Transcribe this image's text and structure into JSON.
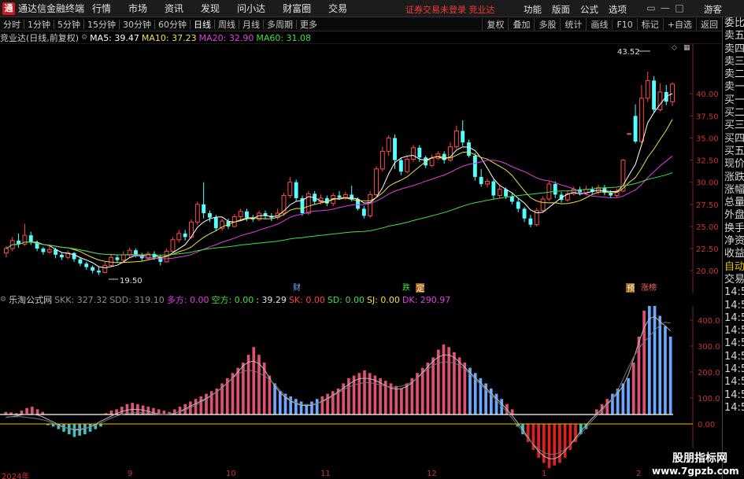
{
  "titlebar": {
    "logo": "通",
    "app_name": "通达信金融终端",
    "menu": [
      "行情",
      "市场",
      "资讯",
      "发现",
      "问小达",
      "财富圈",
      "交易"
    ],
    "alert": "证券交易未登录  竞业达",
    "right_menu": [
      "功能",
      "版面",
      "公式",
      "选项"
    ],
    "guest": "游客"
  },
  "toolbar": {
    "periods": [
      "分时",
      "1分钟",
      "5分钟",
      "15分钟",
      "30分钟",
      "60分钟",
      "日线",
      "周线",
      "月线",
      "多周期",
      "更多"
    ],
    "active_period": "日线",
    "right_buttons": [
      "复权",
      "叠加",
      "多股",
      "统计",
      "画线",
      "F10",
      "标记",
      "+自选",
      "返回"
    ]
  },
  "info": {
    "stock": "竞业达(日线,前复权)",
    "ma5": "MA5: 39.47",
    "ma10": "MA10: 37.23",
    "ma20": "MA20: 32.90",
    "ma60": "MA60: 31.08"
  },
  "indicator": {
    "name": "乐淘公式网",
    "skk": "SKK: 327.32",
    "sdd": "SDD: 319.10",
    "duo": "多方: 0.00",
    "kong": "空方: 0.00",
    "val": ": 39.29",
    "sk": "SK: 0.00",
    "sd": "SD: 0.00",
    "sj": "SJ: 0.00",
    "dk": "DK: 290.97"
  },
  "price_axis": [
    "40.00",
    "37.50",
    "35.00",
    "32.50",
    "30.00",
    "27.50",
    "25.00",
    "22.50",
    "20.00"
  ],
  "ind_axis": [
    "400.0",
    "300.0",
    "200.0",
    "100.0",
    "0.00"
  ],
  "annotations": {
    "high": "43.52",
    "low": "19.50",
    "tag_cai": "财",
    "tag_die": "跌",
    "tag_ding": "定",
    "tag_yu": "预",
    "tag_zhangbang": "涨榜"
  },
  "x_axis": [
    "2024年",
    "9",
    "10",
    "11",
    "12",
    "1",
    "2"
  ],
  "sidebar": [
    "委比",
    "卖五",
    "卖四",
    "卖三",
    "卖二",
    "卖一",
    "买一",
    "买二",
    "买三",
    "买四",
    "买五",
    "现价",
    "涨跌",
    "涨幅",
    "总量",
    "外盘",
    "换手",
    "净资",
    "收益",
    "自动",
    "交易",
    "14:56",
    "14:56",
    "14:56",
    "14:56",
    "14:56",
    "14:56",
    "14:56",
    "14:56",
    "14:56",
    "14:56"
  ],
  "watermark": {
    "line1": "股朋指标网",
    "line2": "www.7gpzb.com"
  },
  "colors": {
    "up": "#ff4a4a",
    "down": "#54ffff",
    "ma5": "#ffffff",
    "ma10": "#f0e040",
    "ma20": "#e040e0",
    "ma60": "#40e040",
    "bar_pos": "#e05070",
    "bar_blue": "#6aa8ff"
  },
  "chart_data": {
    "type": "candlestick",
    "ylim": [
      18.5,
      45
    ],
    "candles": [
      [
        22,
        22.5,
        21.5,
        22.8
      ],
      [
        22.5,
        23.4,
        22.2,
        23.8
      ],
      [
        23.4,
        23,
        22.6,
        24.2
      ],
      [
        23,
        24,
        22.8,
        25.3
      ],
      [
        24,
        23.2,
        22.9,
        24.4
      ],
      [
        23.2,
        22.5,
        22.2,
        23.4
      ],
      [
        22.5,
        22.1,
        21.8,
        22.7
      ],
      [
        22.1,
        22.4,
        21.9,
        22.8
      ],
      [
        22.4,
        21.8,
        21.4,
        22.6
      ],
      [
        21.8,
        21.5,
        21.2,
        22
      ],
      [
        21.5,
        22,
        21.3,
        22.3
      ],
      [
        22,
        21.3,
        21,
        22.1
      ],
      [
        21.3,
        20.8,
        20.5,
        21.5
      ],
      [
        20.8,
        20.4,
        20.1,
        21
      ],
      [
        20.4,
        20,
        19.7,
        20.6
      ],
      [
        20,
        19.8,
        19.5,
        20.4
      ],
      [
        19.8,
        20.6,
        19.7,
        21
      ],
      [
        20.6,
        21.5,
        20.4,
        21.8
      ],
      [
        21.5,
        21.2,
        20.9,
        21.8
      ],
      [
        21.2,
        21.8,
        21,
        22.2
      ],
      [
        21.8,
        22.3,
        21.5,
        22.6
      ],
      [
        22.3,
        21.7,
        21.5,
        22.5
      ],
      [
        21.7,
        21.4,
        21.1,
        22
      ],
      [
        21.4,
        21.9,
        21.2,
        22.2
      ],
      [
        21.9,
        21.5,
        21.2,
        22.2
      ],
      [
        21.5,
        21,
        20.6,
        21.8
      ],
      [
        21,
        22.2,
        20.9,
        22.5
      ],
      [
        22.2,
        23.5,
        22,
        23.8
      ],
      [
        23.5,
        24.2,
        23.2,
        24.6
      ],
      [
        24.2,
        23.8,
        23.4,
        24.6
      ],
      [
        23.8,
        25.5,
        23.6,
        25.8
      ],
      [
        25.5,
        27.5,
        25.2,
        27.8
      ],
      [
        27.5,
        26.5,
        25.9,
        30
      ],
      [
        26.5,
        26,
        25.5,
        26.8
      ],
      [
        26,
        24.8,
        24.5,
        26.3
      ],
      [
        24.8,
        25.6,
        24.5,
        25.9
      ],
      [
        25.6,
        25,
        24.7,
        25.9
      ],
      [
        25,
        26.1,
        24.9,
        26.4
      ],
      [
        26.1,
        26.7,
        25.8,
        27
      ],
      [
        26.7,
        26,
        25.6,
        27
      ],
      [
        26,
        25.8,
        25.5,
        26.3
      ],
      [
        25.8,
        26.5,
        25.6,
        26.8
      ],
      [
        26.5,
        26.2,
        25.8,
        26.8
      ],
      [
        26.2,
        26,
        25.6,
        26.5
      ],
      [
        26,
        26.5,
        25.8,
        27
      ],
      [
        26.5,
        28.5,
        26.2,
        28.8
      ],
      [
        28.5,
        30,
        28.2,
        30.6
      ],
      [
        30,
        28.2,
        27.8,
        30.3
      ],
      [
        28.2,
        26.5,
        26.2,
        28.5
      ],
      [
        26.5,
        28.7,
        26.3,
        29
      ],
      [
        28.7,
        27.8,
        27.5,
        29
      ],
      [
        27.8,
        28.2,
        27.5,
        28.6
      ],
      [
        28.2,
        27.6,
        27.3,
        28.5
      ],
      [
        27.6,
        28.5,
        27.3,
        28.8
      ],
      [
        28.5,
        28.3,
        28,
        29
      ],
      [
        28.3,
        28.6,
        28,
        28.9
      ],
      [
        28.6,
        28.1,
        27.8,
        29.6
      ],
      [
        28.1,
        27,
        26.8,
        28.3
      ],
      [
        27,
        26.2,
        25.9,
        27.3
      ],
      [
        26.2,
        28.6,
        26,
        29
      ],
      [
        28.6,
        31.5,
        28.4,
        31.8
      ],
      [
        31.5,
        33.5,
        31.2,
        34
      ],
      [
        33.5,
        35,
        33,
        35.3
      ],
      [
        35,
        32.5,
        31.5,
        35.4
      ],
      [
        32.5,
        31.2,
        30.8,
        32.8
      ],
      [
        31.2,
        32.6,
        31,
        33
      ],
      [
        32.6,
        33.9,
        32.3,
        34.2
      ],
      [
        33.9,
        32.8,
        32.3,
        34.2
      ],
      [
        32.8,
        31.9,
        31.6,
        33
      ],
      [
        31.9,
        32.7,
        31.7,
        33.1
      ],
      [
        32.7,
        33.2,
        32.5,
        33.5
      ],
      [
        33.2,
        32.5,
        32.1,
        33.5
      ],
      [
        32.5,
        34,
        32.3,
        34.5
      ],
      [
        34,
        35.8,
        33.8,
        36.4
      ],
      [
        35.8,
        34.5,
        34.1,
        37
      ],
      [
        34.5,
        33,
        32.8,
        34.8
      ],
      [
        33,
        30.6,
        30.2,
        33.3
      ],
      [
        30.6,
        29.8,
        29.5,
        31.5
      ],
      [
        29.8,
        30.1,
        29.4,
        30.4
      ],
      [
        30.1,
        28.5,
        28.1,
        30.3
      ],
      [
        28.5,
        29.2,
        28.2,
        29.6
      ],
      [
        29.2,
        28.4,
        28.1,
        29.4
      ],
      [
        28.4,
        27.8,
        27.5,
        28.7
      ],
      [
        27.8,
        27,
        26.6,
        28.1
      ],
      [
        27,
        25.9,
        25.5,
        27.2
      ],
      [
        25.9,
        25.2,
        24.9,
        26.3
      ],
      [
        25.2,
        26.8,
        25,
        27.1
      ],
      [
        26.8,
        28.1,
        26.6,
        28.4
      ],
      [
        28.1,
        29.8,
        27.9,
        30.1
      ],
      [
        29.8,
        28.6,
        28.2,
        30.1
      ],
      [
        28.6,
        28,
        27.7,
        28.9
      ],
      [
        28,
        28.7,
        27.8,
        29
      ],
      [
        28.7,
        29.2,
        28.5,
        29.5
      ],
      [
        29.2,
        28.8,
        28.5,
        29.5
      ],
      [
        28.8,
        29.2,
        28.5,
        29.6
      ],
      [
        29.2,
        28.9,
        28.6,
        29.5
      ],
      [
        28.9,
        29.4,
        28.6,
        29.7
      ],
      [
        29.4,
        28.8,
        28.5,
        29.7
      ],
      [
        28.8,
        28.5,
        28.2,
        29.1
      ],
      [
        28.5,
        29,
        28.3,
        29.3
      ],
      [
        29,
        32.5,
        28.9,
        32.6
      ],
      [
        35.5,
        35.5,
        35.5,
        35.5
      ],
      [
        37.5,
        34.6,
        34.4,
        38.8
      ],
      [
        34.6,
        39.5,
        34.4,
        41
      ],
      [
        39.5,
        41.5,
        39.1,
        42.5
      ],
      [
        41.5,
        38.2,
        37.8,
        42
      ],
      [
        38.2,
        40.2,
        38,
        41.2
      ],
      [
        40.2,
        39.1,
        38.7,
        41
      ],
      [
        39.1,
        41.1,
        38.6,
        41.3
      ]
    ],
    "indicator_bars": [
      10,
      8,
      5,
      15,
      25,
      30,
      20,
      10,
      -5,
      -10,
      -20,
      -30,
      -40,
      -50,
      -45,
      -40,
      -30,
      -20,
      -10,
      5,
      15,
      20,
      30,
      40,
      45,
      40,
      35,
      30,
      25,
      20,
      15,
      10,
      20,
      30,
      40,
      50,
      60,
      70,
      80,
      90,
      100,
      120,
      140,
      160,
      180,
      200,
      230,
      260,
      230,
      200,
      150,
      120,
      90,
      80,
      70,
      60,
      50,
      40,
      50,
      60,
      70,
      80,
      90,
      100,
      120,
      140,
      150,
      160,
      170,
      160,
      150,
      140,
      130,
      120,
      110,
      100,
      120,
      140,
      160,
      180,
      200,
      220,
      250,
      270,
      260,
      240,
      220,
      200,
      180,
      160,
      140,
      120,
      100,
      80,
      60,
      40,
      20,
      -10,
      -40,
      -70,
      -100,
      -130,
      -150,
      -170,
      -160,
      -150,
      -130,
      -100,
      -70,
      -40,
      -20,
      0,
      20,
      40,
      60,
      80,
      100,
      120,
      140,
      200,
      300,
      400,
      440,
      420,
      380,
      340,
      300
    ]
  }
}
